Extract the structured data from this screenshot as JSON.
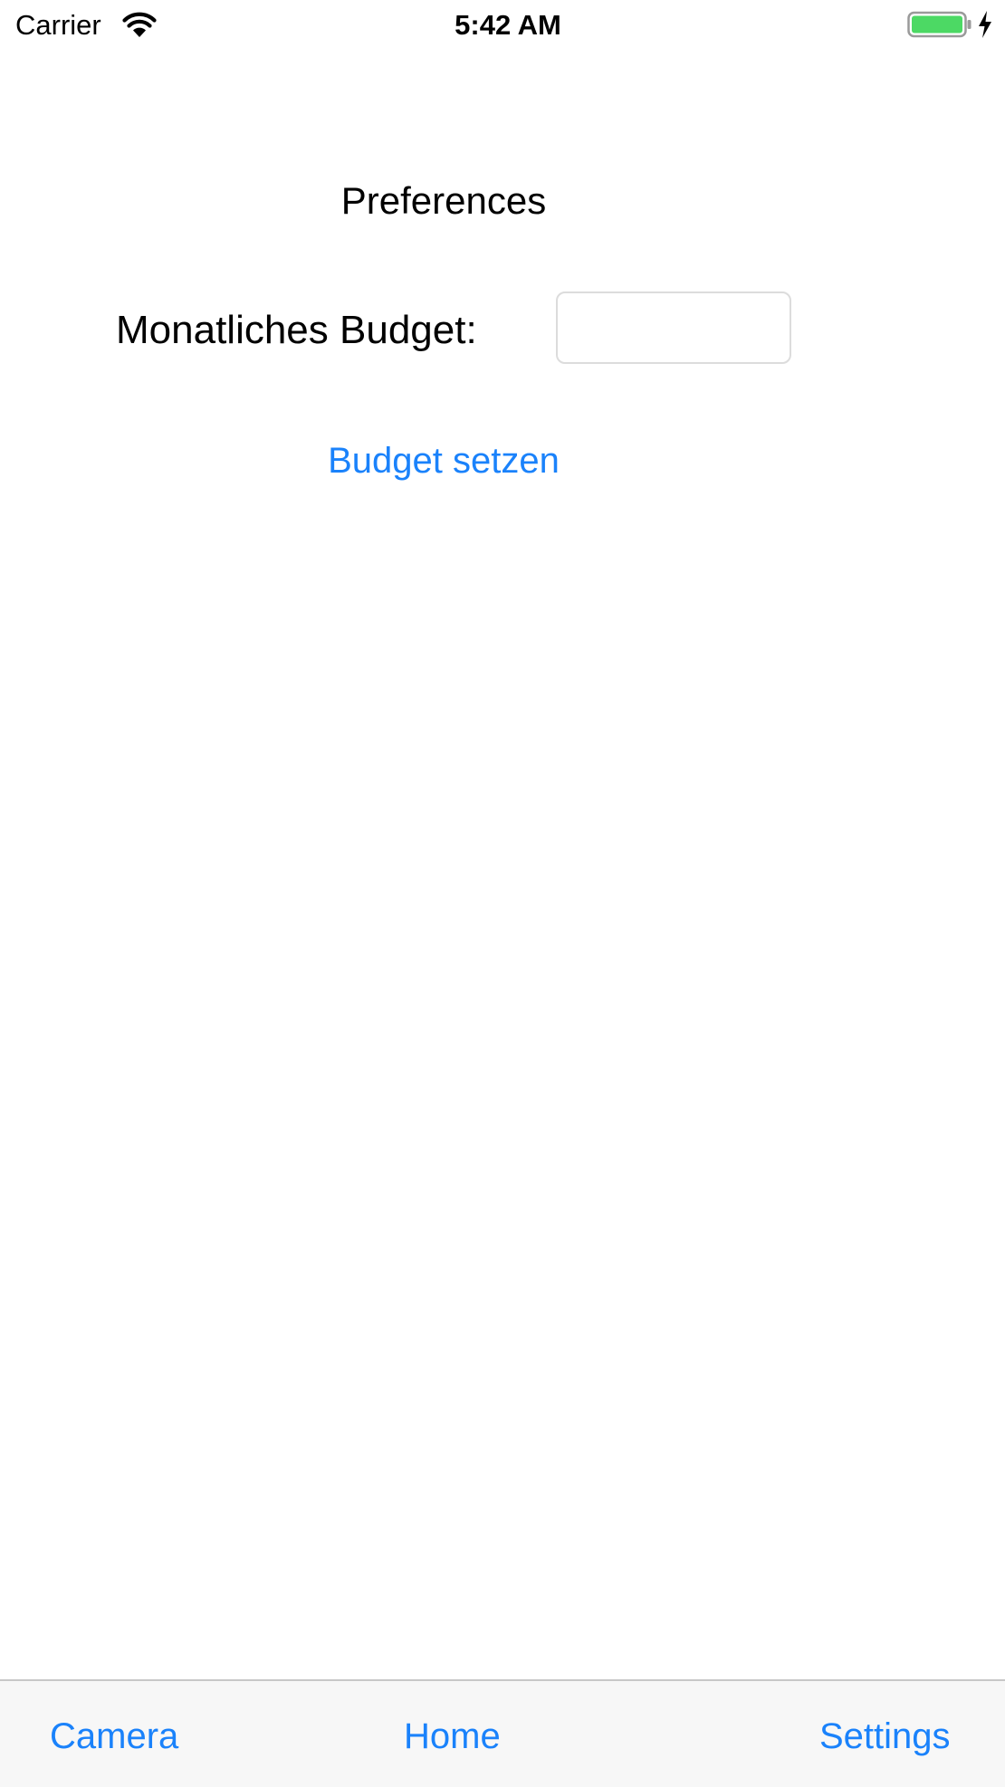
{
  "status_bar": {
    "carrier": "Carrier",
    "time": "5:42 AM",
    "icons": [
      "wifi-icon",
      "battery-icon",
      "charging-icon"
    ],
    "battery_color": "#4cd964"
  },
  "main": {
    "title": "Preferences",
    "budget_label": "Monatliches Budget:",
    "budget_value": "",
    "set_budget_label": "Budget setzen"
  },
  "tab_bar": {
    "tabs": [
      {
        "label": "Camera"
      },
      {
        "label": "Home"
      },
      {
        "label": "Settings"
      }
    ]
  },
  "colors": {
    "accent": "#1a82fb",
    "background": "#ffffff",
    "tab_bar_background": "#f7f7f7"
  }
}
